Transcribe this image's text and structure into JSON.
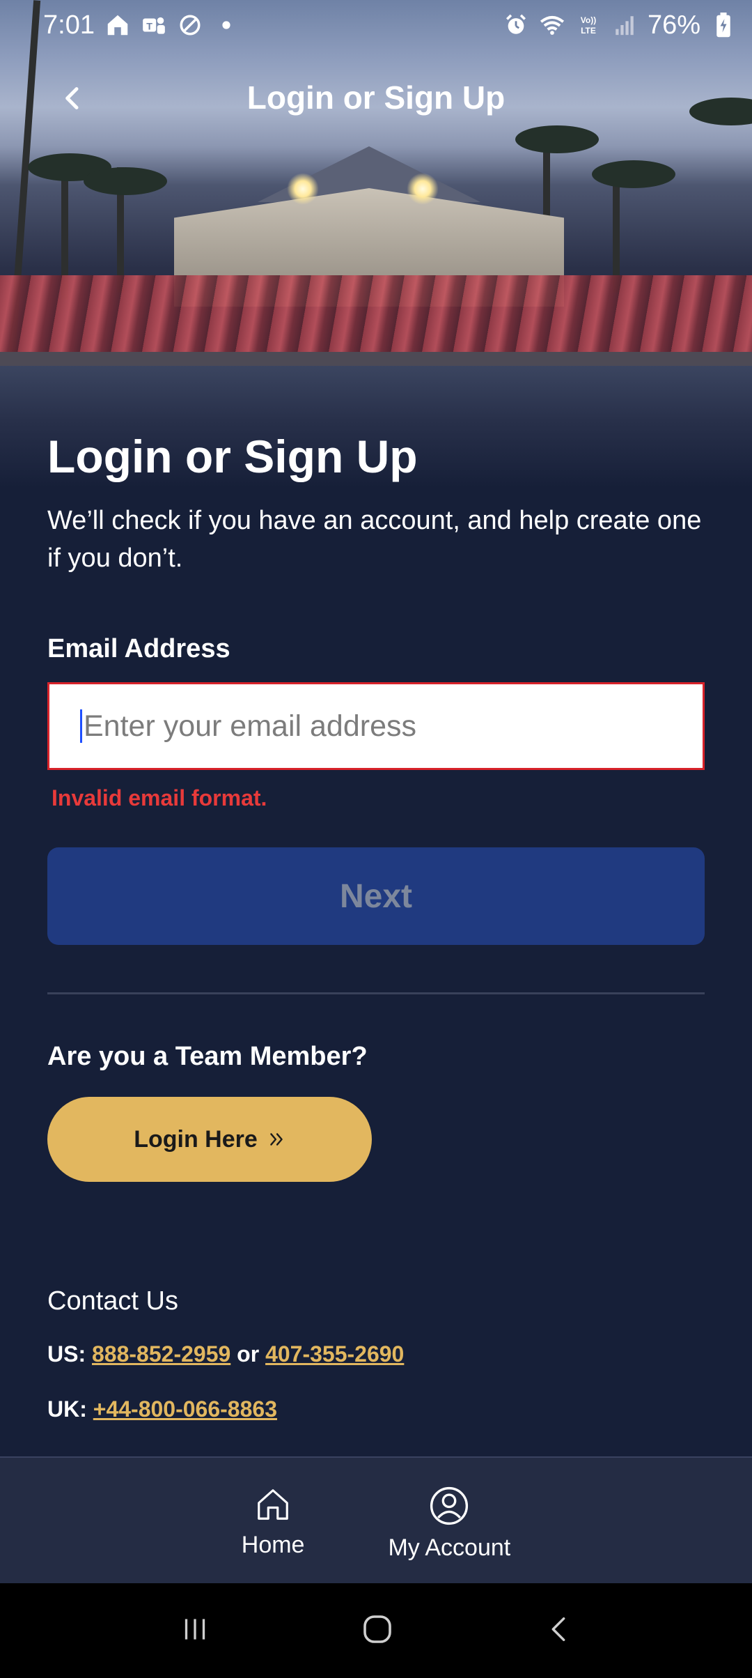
{
  "status_bar": {
    "time": "7:01",
    "battery": "76%",
    "left_icons": [
      "home-icon",
      "teams-icon",
      "do-not-disturb-icon",
      "dot-icon"
    ],
    "right_icons": [
      "alarm-icon",
      "wifi-icon",
      "volte-icon",
      "signal-icon",
      "battery-icon"
    ]
  },
  "header": {
    "title": "Login or Sign Up",
    "back_icon": "chevron-left-icon"
  },
  "main": {
    "title": "Login or Sign Up",
    "subtitle": "We’ll check if you have an account, and help create one if you don’t.",
    "email": {
      "label": "Email Address",
      "value": "",
      "placeholder": "Enter your email address",
      "error": "Invalid email format."
    },
    "next_label": "Next",
    "team_question": "Are you a Team Member?",
    "team_login_label": "Login Here",
    "contact": {
      "title": "Contact Us",
      "us_label": "US:",
      "us_phone_1": "888-852-2959",
      "or_text": "or",
      "us_phone_2": "407-355-2690",
      "uk_label": "UK:",
      "uk_phone": "+44-800-066-8863"
    }
  },
  "bottom_nav": {
    "items": [
      {
        "label": "Home",
        "icon": "home-icon"
      },
      {
        "label": "My Account",
        "icon": "user-circle-icon"
      }
    ]
  },
  "system_nav": [
    "recents-icon",
    "home-circle-icon",
    "back-icon"
  ],
  "colors": {
    "background": "#161f38",
    "accent_gold": "#e2b75f",
    "next_button": "#203a80",
    "error": "#e83a3a"
  }
}
